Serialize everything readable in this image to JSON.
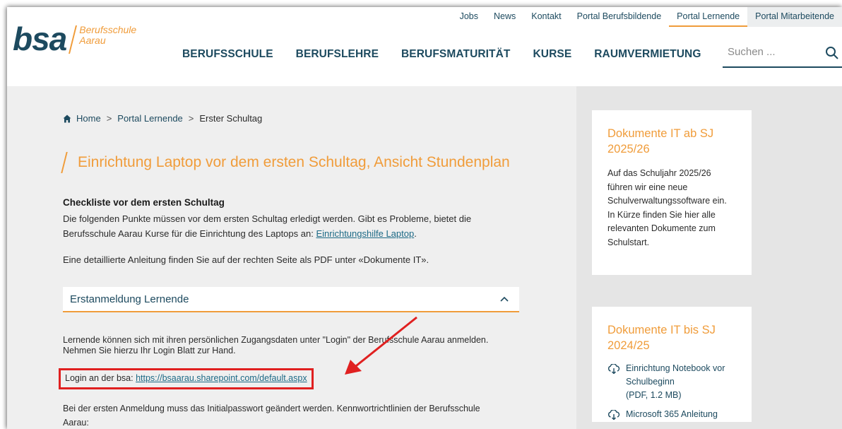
{
  "logo": {
    "word": "bsa",
    "line1": "Berufsschule",
    "line2": "Aarau"
  },
  "topnav": [
    "Jobs",
    "News",
    "Kontakt",
    "Portal Berufsbildende",
    "Portal Lernende",
    "Portal Mitarbeitende"
  ],
  "mainnav": [
    "BERUFSSCHULE",
    "BERUFSLEHRE",
    "BERUFSMATURITÄT",
    "KURSE",
    "RAUMVERMIETUNG"
  ],
  "search": {
    "placeholder": "Suchen ..."
  },
  "breadcrumb": {
    "home": "Home",
    "portal": "Portal Lernende",
    "current": "Erster Schultag",
    "sep": ">"
  },
  "page": {
    "title": "Einrichtung Laptop vor dem ersten Schultag, Ansicht Stundenplan",
    "checklist_head": "Checkliste vor dem ersten Schultag",
    "intro_text": "Die folgenden Punkte müssen vor dem ersten Schultag erledigt werden. Gibt es Probleme, bietet die Berufsschule Aarau Kurse für die Einrichtung des Laptops an: ",
    "intro_link": "Einrichtungshilfe Laptop",
    "intro_end": ".",
    "detail": "Eine detaillierte Anleitung finden Sie auf der rechten Seite als PDF unter «Dokumente IT».",
    "accordion_label": "Erstanmeldung Lernende",
    "p1": "Lernende können sich mit ihren persönlichen Zugangsdaten unter \"Login\" der Berufsschule Aarau anmelden. Nehmen Sie hierzu Ihr Login Blatt zur Hand.",
    "login_prefix": "Login an der bsa: ",
    "login_link": "https://bsaarau.sharepoint.com/default.aspx",
    "p2": "Bei der ersten Anmeldung muss das Initialpasswort geändert werden. Kennwortrichtlinien der Berufsschule Aarau:"
  },
  "sidebar": {
    "card1": {
      "title": "Dokumente IT ab SJ 2025/26",
      "text": "Auf das Schuljahr 2025/26 führen wir eine neue Schulverwaltungssoftware ein. In Kürze finden Sie hier alle relevanten Dokumente zum Schulstart."
    },
    "card2": {
      "title": "Dokumente IT bis SJ 2024/25",
      "items": [
        {
          "label": "Einrichtung Notebook vor Schulbeginn",
          "meta": "(PDF, 1.2 MB)"
        },
        {
          "label": "Microsoft 365 Anleitung",
          "meta": ""
        }
      ]
    }
  },
  "colors": {
    "brand": "#1d4a5f",
    "accent": "#f09c3a",
    "highlight": "#e02020"
  }
}
